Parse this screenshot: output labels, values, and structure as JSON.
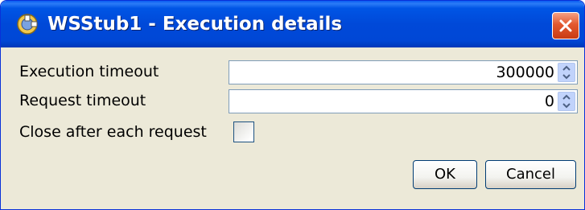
{
  "window": {
    "title": "WSStub1 - Execution details",
    "icon": "app-icon",
    "close_icon": "close-icon"
  },
  "form": {
    "execution_timeout": {
      "label": "Execution timeout",
      "value": "300000"
    },
    "request_timeout": {
      "label": "Request timeout",
      "value": "0"
    },
    "close_after_each_request": {
      "label": "Close after each request",
      "checked": false
    }
  },
  "buttons": {
    "ok_label": "OK",
    "cancel_label": "Cancel"
  },
  "colors": {
    "titlebar": "#0055e5",
    "window_bg": "#ece9d8",
    "close_button": "#e3582f",
    "field_border": "#7f9db9"
  }
}
